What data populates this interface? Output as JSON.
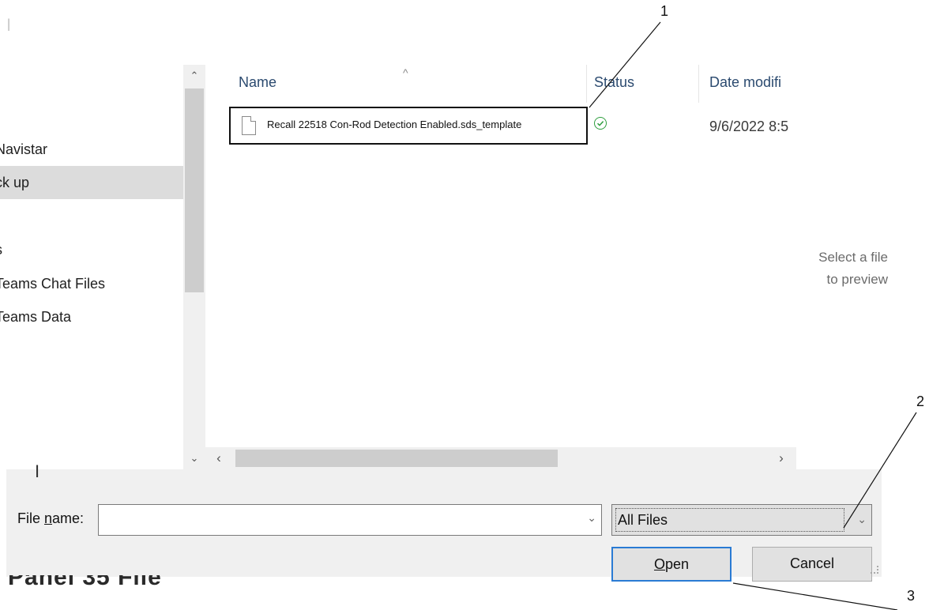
{
  "nav": {
    "items": [
      {
        "label": "Navistar"
      },
      {
        "label": "ck up"
      },
      {
        "label": "s"
      },
      {
        "label": "Teams Chat Files"
      },
      {
        "label": "Teams Data"
      }
    ]
  },
  "list": {
    "columns": {
      "name": "Name",
      "status": "Status",
      "date": "Date modifi"
    },
    "sort_indicator": "^",
    "files": [
      {
        "name": "Recall 22518 Con-Rod Detection Enabled.sds_template",
        "status": "synced",
        "date": "9/6/2022 8:5"
      }
    ]
  },
  "preview": {
    "line1": "Select a file",
    "line2": "to preview"
  },
  "bottom": {
    "file_name_label_pre": "File ",
    "file_name_label_u": "n",
    "file_name_label_post": "ame:",
    "file_name_value": "",
    "file_type": "All Files",
    "open_label_u": "O",
    "open_label_rest": "pen",
    "cancel_label": "Cancel"
  },
  "underlying_text": "Panel 35 File",
  "callouts": [
    "1",
    "2",
    "3"
  ],
  "icons": {
    "file": "document-icon",
    "status": "checkmark-circle-icon",
    "dropdown": "chevron-down-icon",
    "scroll_up": "chevron-up-icon",
    "scroll_down": "chevron-down-icon",
    "scroll_left": "chevron-left-icon",
    "scroll_right": "chevron-right-icon"
  },
  "colors": {
    "accent": "#2a7bd4",
    "status_ok": "#2e9e3e",
    "header_text": "#2b4a6f"
  }
}
